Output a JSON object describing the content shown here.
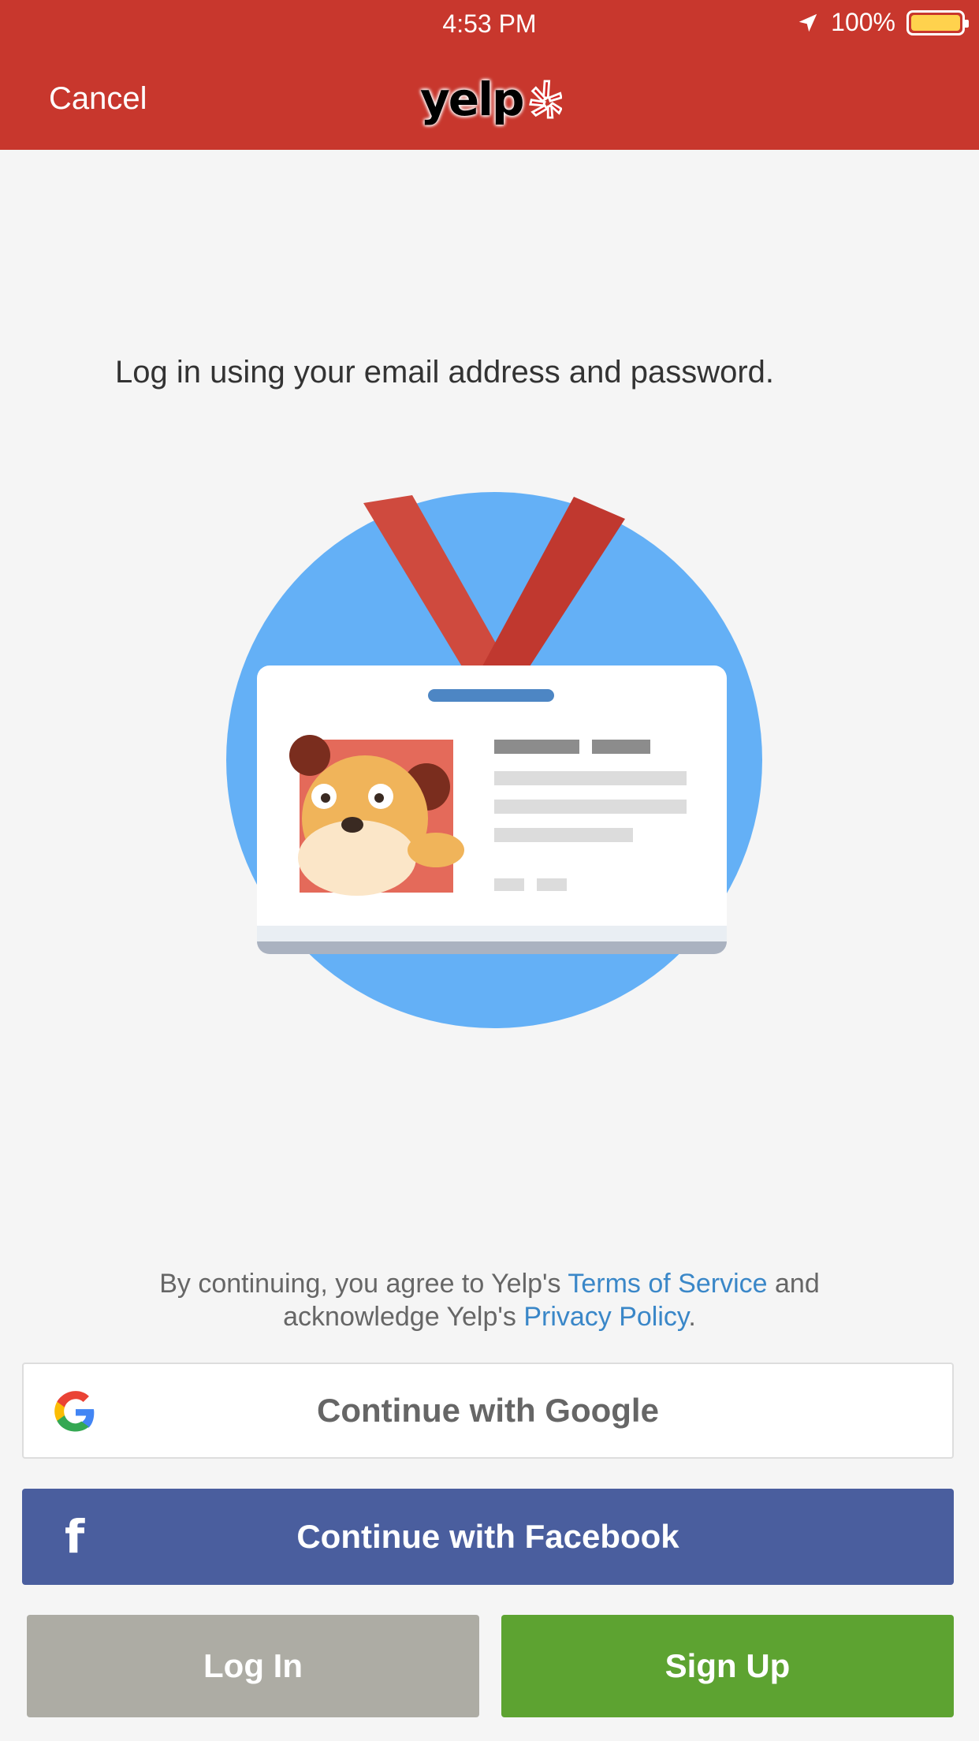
{
  "status_bar": {
    "time": "4:53 PM",
    "battery": "100%"
  },
  "header": {
    "cancel_label": "Cancel",
    "logo_text": "yelp"
  },
  "main": {
    "instructions": "Log in using your email address and password."
  },
  "legal": {
    "prefix": "By continuing, you agree to Yelp's ",
    "terms_link": "Terms of Service",
    "middle": " and acknowledge Yelp's ",
    "privacy_link": "Privacy Policy",
    "suffix": "."
  },
  "buttons": {
    "google": "Continue with Google",
    "facebook": "Continue with Facebook",
    "login": "Log In",
    "signup": "Sign Up"
  },
  "colors": {
    "header_bg": "#c8372d",
    "facebook": "#4a5e9e",
    "login": "#adaca4",
    "signup": "#5da331",
    "link": "#3a87c8"
  },
  "icons": {
    "location": "location-arrow-icon",
    "battery": "battery-icon",
    "google": "google-icon",
    "facebook": "facebook-icon",
    "yelp_burst": "yelp-burst-icon"
  }
}
